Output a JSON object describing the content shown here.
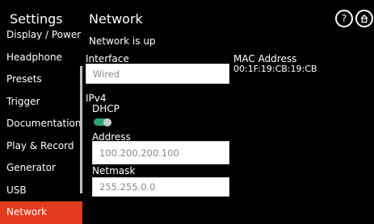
{
  "header": {
    "sidebar_title": "Settings",
    "page_title": "Network",
    "help_label": "?",
    "icons": {
      "help": "help-icon",
      "home": "home-icon"
    }
  },
  "sidebar": {
    "items": [
      {
        "label": "Display / Power"
      },
      {
        "label": "Headphone"
      },
      {
        "label": "Presets"
      },
      {
        "label": "Trigger"
      },
      {
        "label": "Documentation"
      },
      {
        "label": "Play & Record"
      },
      {
        "label": "Generator"
      },
      {
        "label": "USB"
      },
      {
        "label": "Network"
      }
    ],
    "active_index": 8
  },
  "main": {
    "status": "Network is up",
    "interface": {
      "label": "Interface",
      "value": "Wired"
    },
    "mac": {
      "label": "MAC Address",
      "value": "00:1F:19:CB:19:CB"
    },
    "ipv4": {
      "label": "IPv4",
      "dhcp": {
        "label": "DHCP",
        "enabled": true
      },
      "address": {
        "label": "Address",
        "value": "100.200.200.100"
      },
      "netmask": {
        "label": "Netmask",
        "value": "255.255.0.0"
      }
    }
  },
  "colors": {
    "accent": "#e43a1d",
    "toggle_on": "#2aa56a",
    "background": "#000000"
  }
}
